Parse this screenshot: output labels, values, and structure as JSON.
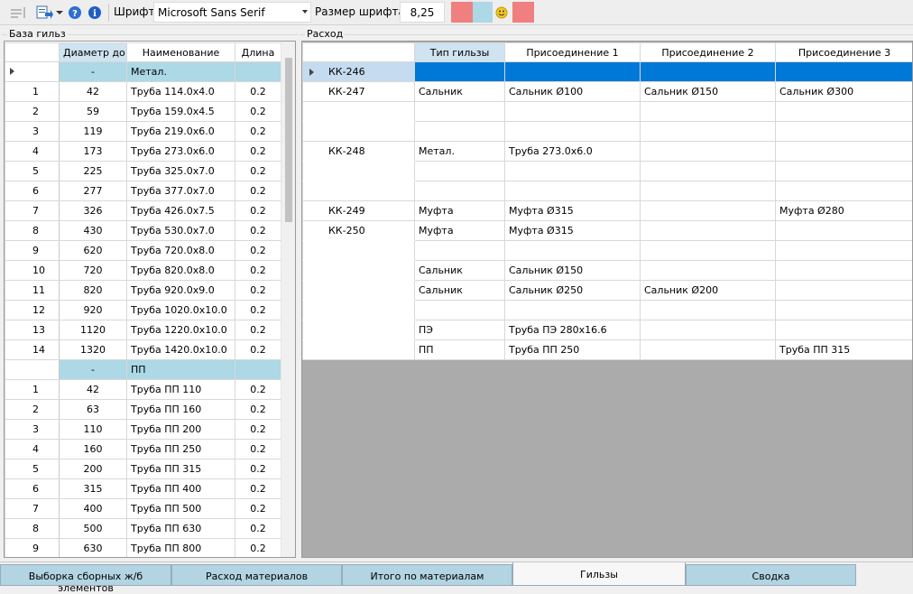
{
  "toolbar": {
    "font_label": "Шрифт",
    "font_value": "Microsoft Sans Serif",
    "size_label": "Размер шрифта",
    "size_value": "8,25",
    "swatch_colors": [
      "#f08080",
      "#add8e6",
      "#f08080"
    ],
    "icons": [
      "align-icon",
      "export-icon",
      "help-icon",
      "info-icon",
      "smiley-icon"
    ]
  },
  "left": {
    "title": "База гильз",
    "columns": [
      "Диаметр до",
      "Наименование",
      "Длина"
    ],
    "rows": [
      {
        "n": "",
        "d": "-",
        "name": "Метал.",
        "len": "",
        "kind": "selected"
      },
      {
        "n": "1",
        "d": "42",
        "name": "Труба 114.0x4.0",
        "len": "0.2"
      },
      {
        "n": "2",
        "d": "59",
        "name": "Труба 159.0x4.5",
        "len": "0.2"
      },
      {
        "n": "3",
        "d": "119",
        "name": "Труба 219.0x6.0",
        "len": "0.2"
      },
      {
        "n": "4",
        "d": "173",
        "name": "Труба 273.0x6.0",
        "len": "0.2"
      },
      {
        "n": "5",
        "d": "225",
        "name": "Труба 325.0x7.0",
        "len": "0.2"
      },
      {
        "n": "6",
        "d": "277",
        "name": "Труба 377.0x7.0",
        "len": "0.2"
      },
      {
        "n": "7",
        "d": "326",
        "name": "Труба 426.0x7.5",
        "len": "0.2"
      },
      {
        "n": "8",
        "d": "430",
        "name": "Труба 530.0x7.0",
        "len": "0.2"
      },
      {
        "n": "9",
        "d": "620",
        "name": "Труба 720.0x8.0",
        "len": "0.2"
      },
      {
        "n": "10",
        "d": "720",
        "name": "Труба 820.0x8.0",
        "len": "0.2"
      },
      {
        "n": "11",
        "d": "820",
        "name": "Труба 920.0x9.0",
        "len": "0.2"
      },
      {
        "n": "12",
        "d": "920",
        "name": "Труба 1020.0x10.0",
        "len": "0.2"
      },
      {
        "n": "13",
        "d": "1120",
        "name": "Труба 1220.0x10.0",
        "len": "0.2"
      },
      {
        "n": "14",
        "d": "1320",
        "name": "Труба 1420.0x10.0",
        "len": "0.2"
      },
      {
        "n": "",
        "d": "-",
        "name": "ПП",
        "len": "",
        "kind": "group"
      },
      {
        "n": "1",
        "d": "42",
        "name": "Труба ПП 110",
        "len": "0.2"
      },
      {
        "n": "2",
        "d": "63",
        "name": "Труба ПП 160",
        "len": "0.2"
      },
      {
        "n": "3",
        "d": "110",
        "name": "Труба ПП 200",
        "len": "0.2"
      },
      {
        "n": "4",
        "d": "160",
        "name": "Труба ПП 250",
        "len": "0.2"
      },
      {
        "n": "5",
        "d": "200",
        "name": "Труба ПП 315",
        "len": "0.2"
      },
      {
        "n": "6",
        "d": "315",
        "name": "Труба ПП 400",
        "len": "0.2"
      },
      {
        "n": "7",
        "d": "400",
        "name": "Труба ПП 500",
        "len": "0.2"
      },
      {
        "n": "8",
        "d": "500",
        "name": "Труба ПП 630",
        "len": "0.2"
      },
      {
        "n": "9",
        "d": "630",
        "name": "Труба ПП 800",
        "len": "0.2"
      }
    ]
  },
  "right": {
    "title": "Расход",
    "columns": [
      "Тип гильзы",
      "Присоединение 1",
      "Присоединение 2",
      "Присоединение 3"
    ],
    "rows": [
      {
        "id": "КК-246",
        "type": "",
        "c1": "",
        "c2": "",
        "c3": "",
        "kind": "selected"
      },
      {
        "id": "КК-247",
        "type": "Сальник",
        "c1": "Сальник Ø100",
        "c2": "Сальник Ø150",
        "c3": "Сальник Ø300"
      },
      {
        "id": "",
        "type": "",
        "c1": "",
        "c2": "",
        "c3": "",
        "kind": "noline"
      },
      {
        "id": "",
        "type": "",
        "c1": "",
        "c2": "",
        "c3": ""
      },
      {
        "id": "КК-248",
        "type": "Метал.",
        "c1": "Труба 273.0x6.0",
        "c2": "",
        "c3": "",
        "kind": "noline"
      },
      {
        "id": "",
        "type": "",
        "c1": "",
        "c2": "",
        "c3": "",
        "kind": "noline"
      },
      {
        "id": "",
        "type": "",
        "c1": "",
        "c2": "",
        "c3": ""
      },
      {
        "id": "КК-249",
        "type": "Муфта",
        "c1": "Муфта Ø315",
        "c2": "",
        "c3": "Муфта Ø280"
      },
      {
        "id": "КК-250",
        "type": "Муфта",
        "c1": "Муфта Ø315",
        "c2": "",
        "c3": "",
        "kind": "noline"
      },
      {
        "id": "",
        "type": "",
        "c1": "",
        "c2": "",
        "c3": "",
        "kind": "noline"
      },
      {
        "id": "",
        "type": "Сальник",
        "c1": "Сальник Ø150",
        "c2": "",
        "c3": "",
        "kind": "noline"
      },
      {
        "id": "",
        "type": "Сальник",
        "c1": "Сальник Ø250",
        "c2": "Сальник Ø200",
        "c3": "",
        "kind": "noline"
      },
      {
        "id": "",
        "type": "",
        "c1": "",
        "c2": "",
        "c3": "",
        "kind": "noline"
      },
      {
        "id": "",
        "type": "ПЭ",
        "c1": "Труба ПЭ 280x16.6",
        "c2": "",
        "c3": "",
        "kind": "noline"
      },
      {
        "id": "",
        "type": "ПП",
        "c1": "Труба ПП 250",
        "c2": "",
        "c3": "Труба ПП 315"
      }
    ]
  },
  "tabs": [
    {
      "label": "Выборка сборных ж/б элементов",
      "active": false
    },
    {
      "label": "Расход материалов",
      "active": false
    },
    {
      "label": "Итого по материалам",
      "active": false
    },
    {
      "label": "Гильзы",
      "active": true
    },
    {
      "label": "Сводка",
      "active": false
    }
  ]
}
